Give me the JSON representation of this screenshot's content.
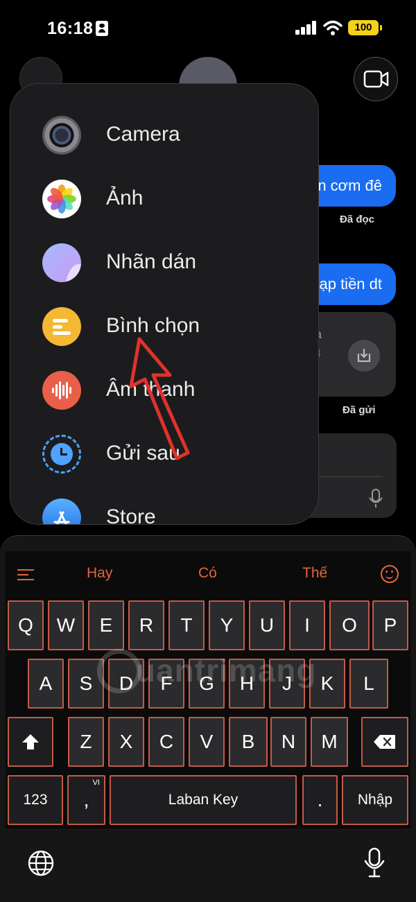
{
  "status_bar": {
    "time": "16:18",
    "battery": "100"
  },
  "chat": {
    "messages": [
      {
        "text": "n cơm đê",
        "receipt": "Đã đọc"
      },
      {
        "text": "ạp tiền dt",
        "receipt": "Đã gửi"
      }
    ],
    "attachment_ghost": {
      "line1": "ạ",
      "line2": "4"
    }
  },
  "attach_menu": {
    "items": [
      {
        "label": "Camera",
        "icon": "camera-icon"
      },
      {
        "label": "Ảnh",
        "icon": "photos-icon"
      },
      {
        "label": "Nhãn dán",
        "icon": "sticker-icon"
      },
      {
        "label": "Bình chọn",
        "icon": "poll-icon"
      },
      {
        "label": "Âm thanh",
        "icon": "audio-icon"
      },
      {
        "label": "Gửi sau",
        "icon": "schedule-icon"
      },
      {
        "label": "Store",
        "icon": "store-icon"
      }
    ],
    "highlight_color": "#e0322a"
  },
  "keyboard": {
    "accent_color": "#e0673f",
    "suggestions": [
      "Hay",
      "Có",
      "Thế"
    ],
    "row1": [
      "Q",
      "W",
      "E",
      "R",
      "T",
      "Y",
      "U",
      "I",
      "O",
      "P"
    ],
    "row2": [
      "A",
      "S",
      "D",
      "F",
      "G",
      "H",
      "J",
      "K",
      "L"
    ],
    "row3": [
      "Z",
      "X",
      "C",
      "V",
      "B",
      "N",
      "M"
    ],
    "numbers_key": "123",
    "comma_key": ",",
    "comma_sup": "VI",
    "space_key": "Laban Key",
    "period_key": ".",
    "enter_key": "Nhập"
  },
  "watermark": "uantrimang"
}
